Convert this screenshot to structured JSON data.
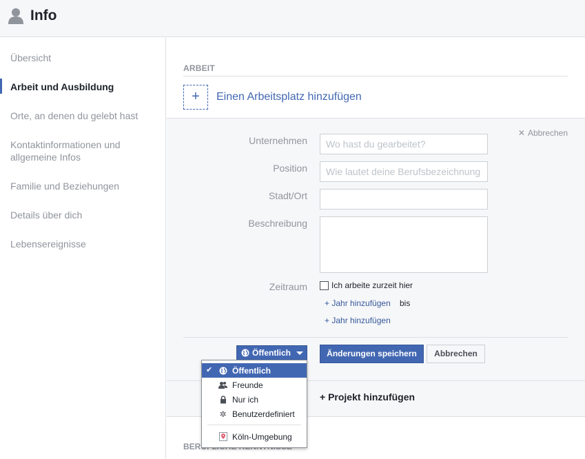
{
  "header": {
    "title": "Info"
  },
  "sidebar": {
    "items": [
      {
        "label": "Übersicht"
      },
      {
        "label": "Arbeit und Ausbildung"
      },
      {
        "label": "Orte, an denen du gelebt hast"
      },
      {
        "label": "Kontaktinformationen und allgemeine Infos"
      },
      {
        "label": "Familie und Beziehungen"
      },
      {
        "label": "Details über dich"
      },
      {
        "label": "Lebensereignisse"
      }
    ]
  },
  "main": {
    "section_title": "ARBEIT",
    "add_workplace": "Einen Arbeitsplatz hinzufügen",
    "add_icon": "+",
    "cancel_top": "Abbrechen",
    "form": {
      "company_label": "Unternehmen",
      "company_placeholder": "Wo hast du gearbeitet?",
      "position_label": "Position",
      "position_placeholder": "Wie lautet deine Berufsbezeichnung",
      "city_label": "Stadt/Ort",
      "city_value": "",
      "description_label": "Beschreibung",
      "description_value": "",
      "period_label": "Zeitraum",
      "currently_working": "Ich arbeite zurzeit hier",
      "currently_working_checked": false,
      "add_year_1": "+ Jahr hinzufügen",
      "bis": "bis",
      "add_year_2": "+ Jahr hinzufügen"
    },
    "privacy_button": "Öffentlich",
    "save_button": "Änderungen speichern",
    "cancel_button": "Abbrechen",
    "add_project": "+ Projekt hinzufügen",
    "bottom_section_title": "BERUFLICHE KENNTNISSE"
  },
  "dropdown": {
    "items": [
      {
        "label": "Öffentlich",
        "icon": "globe-icon",
        "selected": true
      },
      {
        "label": "Freunde",
        "icon": "friends-icon",
        "selected": false
      },
      {
        "label": "Nur ich",
        "icon": "lock-icon",
        "selected": false
      },
      {
        "label": "Benutzerdefiniert",
        "icon": "gear-icon",
        "selected": false
      },
      {
        "label": "Köln-Umgebung",
        "icon": "location-pin-icon",
        "selected": false
      }
    ]
  },
  "colors": {
    "accent": "#4267b2",
    "link": "#365899",
    "muted": "#90949c"
  }
}
